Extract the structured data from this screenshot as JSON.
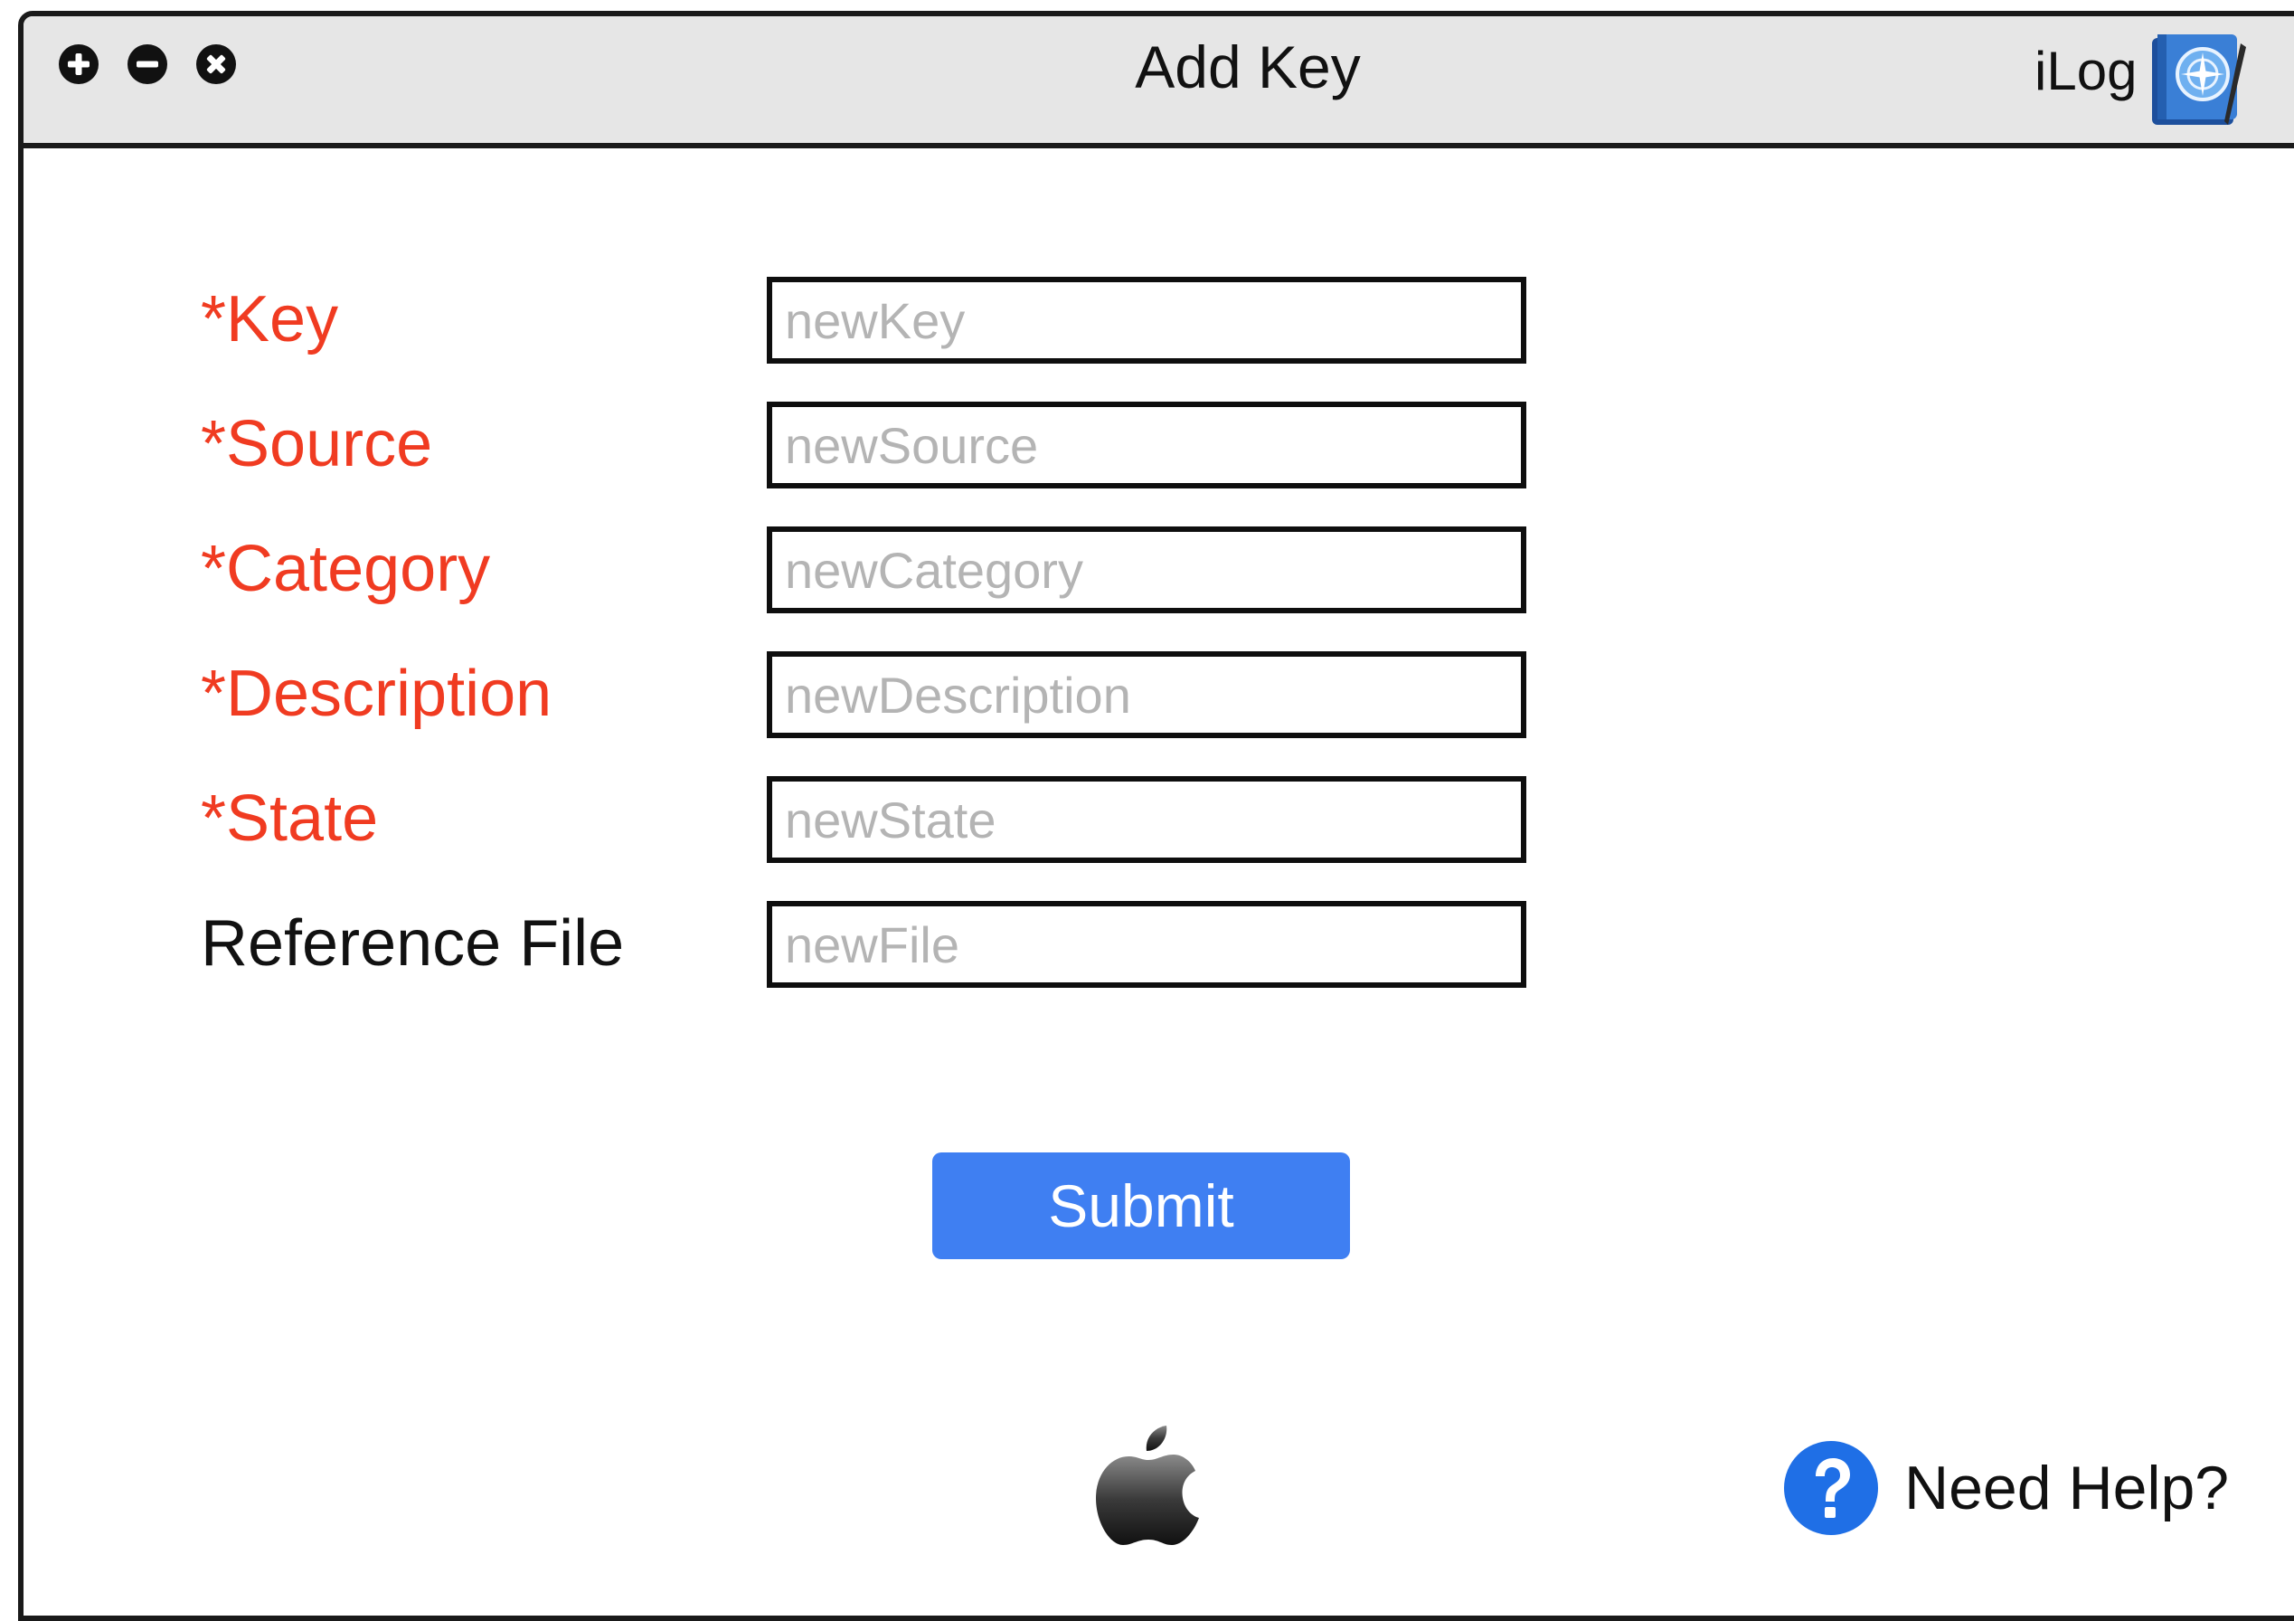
{
  "window": {
    "title": "Add Key",
    "app_name": "iLog",
    "controls": [
      "plus-icon",
      "minus-icon",
      "close-icon"
    ]
  },
  "form": {
    "fields": [
      {
        "label": "*Key",
        "placeholder": "newKey",
        "required": true
      },
      {
        "label": "*Source",
        "placeholder": "newSource",
        "required": true
      },
      {
        "label": "*Category",
        "placeholder": "newCategory",
        "required": true
      },
      {
        "label": "*Description",
        "placeholder": "newDescription",
        "required": true
      },
      {
        "label": "*State",
        "placeholder": "newState",
        "required": true
      },
      {
        "label": "Reference File",
        "placeholder": "newFile",
        "required": false
      }
    ],
    "submit_label": "Submit"
  },
  "footer": {
    "help_label": "Need Help?"
  },
  "colors": {
    "required_label": "#f03b21",
    "button": "#3f7ff2",
    "help_icon": "#1f6fe6",
    "titlebar": "#e6e6e6"
  }
}
